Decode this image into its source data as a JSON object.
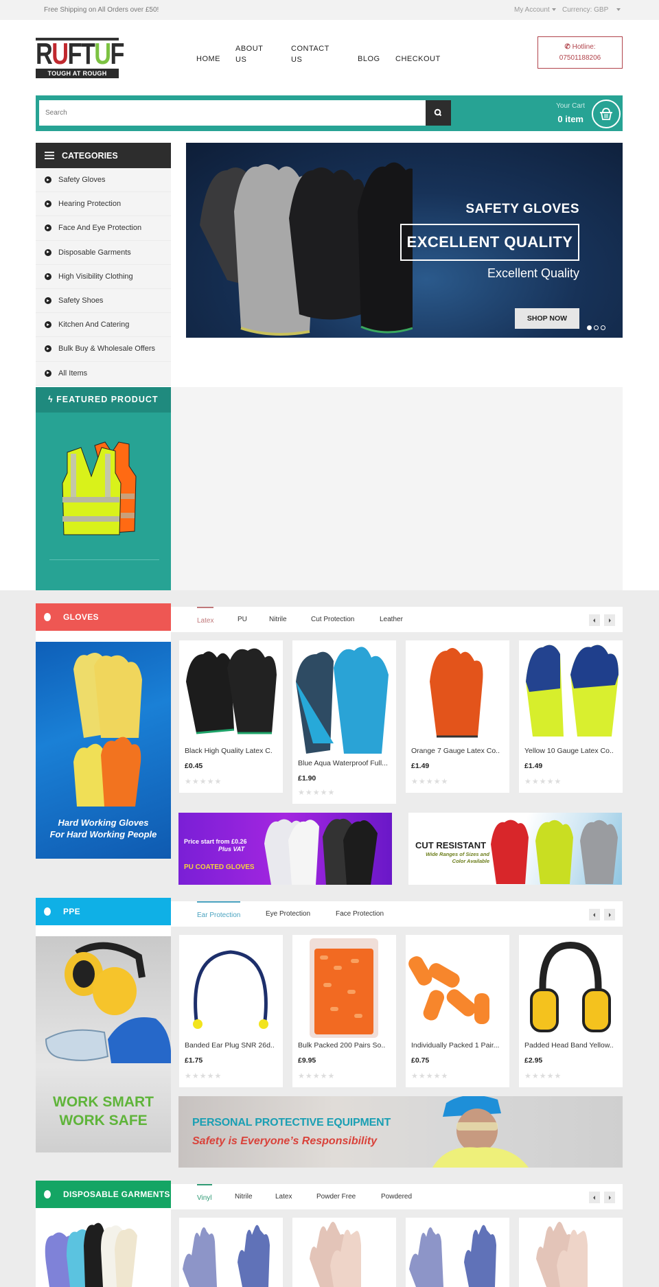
{
  "topbar": {
    "shipping": "Free Shipping on All Orders over £50!",
    "account": "My Account",
    "currency": "Currency: GBP"
  },
  "logo": {
    "letters": [
      "R",
      "U",
      "F",
      "T",
      "U",
      "F"
    ],
    "tagline": "TOUGH AT ROUGH"
  },
  "nav": [
    {
      "label": "HOME"
    },
    {
      "label": "ABOUT US"
    },
    {
      "label": "CONTACT US"
    },
    {
      "label": "BLOG"
    },
    {
      "label": "CHECKOUT"
    }
  ],
  "hotline": {
    "label": "Hotline:",
    "number": "07501188206"
  },
  "search": {
    "placeholder": "Search"
  },
  "cart": {
    "label": "Your Cart",
    "count": "0 item"
  },
  "categories": {
    "title": "CATEGORIES",
    "items": [
      {
        "label": "Safety Gloves"
      },
      {
        "label": "Hearing Protection"
      },
      {
        "label": "Face And Eye Protection"
      },
      {
        "label": "Disposable Garments"
      },
      {
        "label": "High Visibility Clothing"
      },
      {
        "label": "Safety Shoes"
      },
      {
        "label": "Kitchen And Catering"
      },
      {
        "label": "Bulk Buy & Wholesale Offers"
      },
      {
        "label": "All Items"
      }
    ]
  },
  "hero": {
    "title": "SAFETY GLOVES",
    "headline": "EXCELLENT QUALITY",
    "subtitle": "Excellent Quality",
    "cta": "SHOP NOW",
    "slides": 3,
    "active_slide": 1
  },
  "featured": {
    "title": "FEATURED PRODUCT"
  },
  "sections": [
    {
      "title": "GLOVES",
      "color": "#ee5753",
      "tab_color": "#c0787a",
      "banner_text": [
        "Hard Working Gloves",
        "For Hard Working People"
      ],
      "tabs": [
        "Latex",
        "PU",
        "Nitrile",
        "Cut Protection",
        "Leather"
      ],
      "active_tab": 0,
      "products": [
        {
          "name": "Black High Quality Latex C.",
          "price": "£0.45",
          "rating": 0
        },
        {
          "name": "Blue Aqua Waterproof Full...",
          "price": "£1.90",
          "rating": 0
        },
        {
          "name": "Orange 7 Gauge Latex Co..",
          "price": "£1.49",
          "rating": 0
        },
        {
          "name": "Yellow 10 Gauge Latex Co..",
          "price": "£1.49",
          "rating": 0
        }
      ],
      "promos": [
        {
          "line1": "Price start from £0.26",
          "line2": "Plus VAT",
          "line3": "PU COATED GLOVES"
        },
        {
          "line1": "CUT RESISTANT",
          "line2": "Wide Ranges of Sizes and",
          "line3": "Color Available"
        }
      ]
    },
    {
      "title": "PPE",
      "color": "#0fb0e6",
      "tab_color": "#4aa3c0",
      "banner_text": [
        "WORK SMART",
        "WORK SAFE"
      ],
      "tabs": [
        "Ear Protection",
        "Eye Protection",
        "Face Protection"
      ],
      "active_tab": 0,
      "products": [
        {
          "name": "Banded Ear Plug SNR 26d..",
          "price": "£1.75",
          "rating": 0
        },
        {
          "name": "Bulk Packed 200 Pairs So..",
          "price": "£9.95",
          "rating": 0
        },
        {
          "name": "Individually Packed 1 Pair...",
          "price": "£0.75",
          "rating": 0
        },
        {
          "name": "Padded Head Band Yellow..",
          "price": "£2.95",
          "rating": 0
        }
      ],
      "promo": {
        "line1": "PERSONAL PROTECTIVE EQUIPMENT",
        "line2": "Safety is Everyone’s Responsibility"
      }
    },
    {
      "title": "DISPOSABLE GARMENTS",
      "color": "#14a564",
      "tab_color": "#2f9a74",
      "tabs": [
        "Vinyl",
        "Nitrile",
        "Latex",
        "Powder Free",
        "Powdered"
      ],
      "active_tab": 0
    }
  ]
}
